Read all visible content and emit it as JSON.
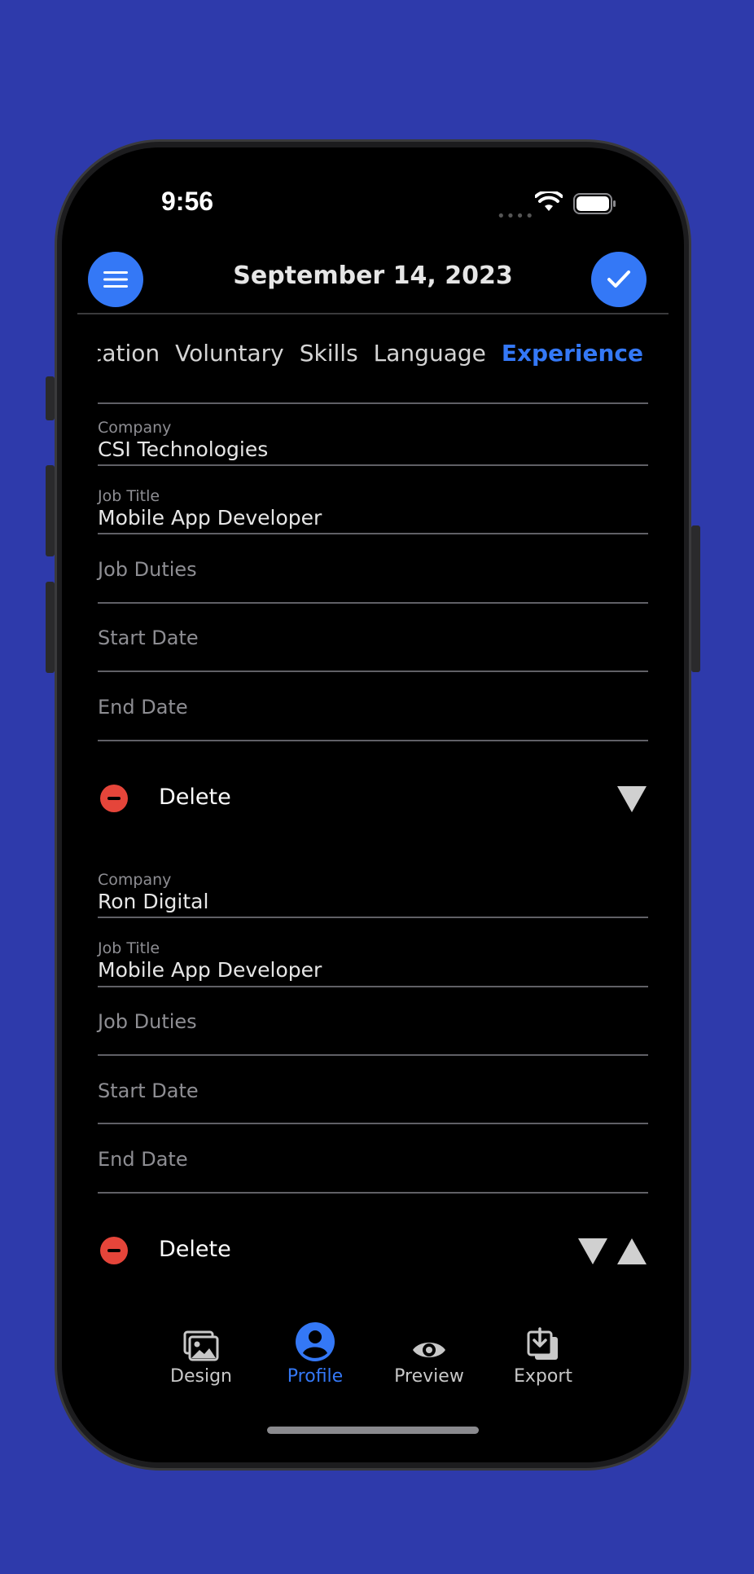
{
  "status_bar": {
    "time": "9:56"
  },
  "header": {
    "title": "September 14, 2023"
  },
  "icons": {
    "menu": "menu-icon",
    "confirm": "checkmark-icon"
  },
  "tabs": [
    {
      "label": "Education",
      "active": false
    },
    {
      "label": "Voluntary",
      "active": false
    },
    {
      "label": "Skills",
      "active": false
    },
    {
      "label": "Language",
      "active": false
    },
    {
      "label": "Experience",
      "active": true
    }
  ],
  "experiences": [
    {
      "company_label": "Company",
      "company": "CSI Technologies",
      "job_title_label": "Job Title",
      "job_title": "Mobile App Developer",
      "job_duties_placeholder": "Job Duties",
      "start_date_placeholder": "Start Date",
      "end_date_placeholder": "End Date",
      "delete_label": "Delete"
    },
    {
      "company_label": "Company",
      "company": "Ron Digital",
      "job_title_label": "Job Title",
      "job_title": "Mobile App Developer",
      "job_duties_placeholder": "Job Duties",
      "start_date_placeholder": "Start Date",
      "end_date_placeholder": "End Date",
      "delete_label": "Delete"
    }
  ],
  "bottom_nav": [
    {
      "label": "Design",
      "icon": "images-icon",
      "active": false
    },
    {
      "label": "Profile",
      "icon": "profile-icon",
      "active": true
    },
    {
      "label": "Preview",
      "icon": "eye-icon",
      "active": false
    },
    {
      "label": "Export",
      "icon": "export-icon",
      "active": false
    }
  ],
  "colors": {
    "background": "#2e3aab",
    "accent": "#3478f6",
    "danger": "#e5453a",
    "screen": "#000000"
  }
}
